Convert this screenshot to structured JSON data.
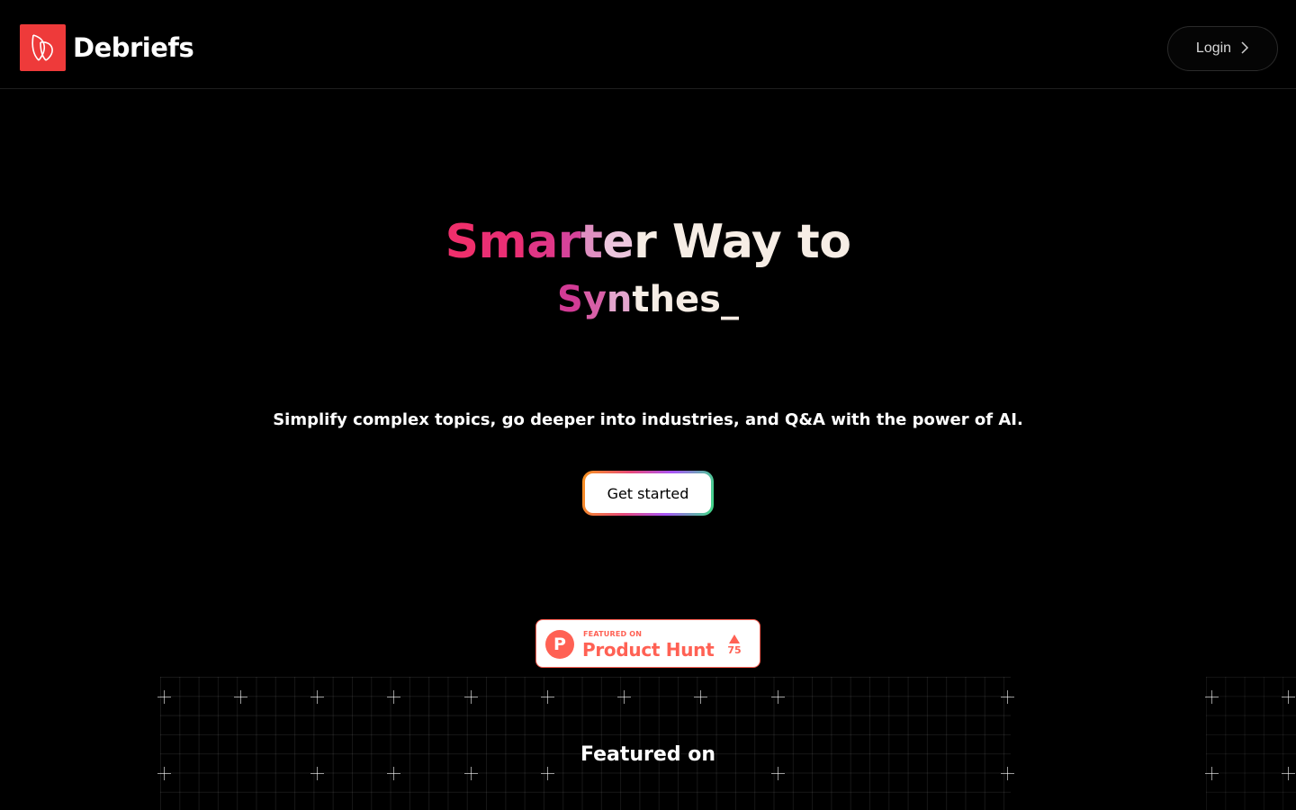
{
  "brand": {
    "name": "Debriefs",
    "accent": "#ee3a3a"
  },
  "nav": {
    "login_label": "Login"
  },
  "hero": {
    "title_parts": [
      {
        "text": "S",
        "color": "#ef2f6c"
      },
      {
        "text": "m",
        "color": "#ea2f74"
      },
      {
        "text": "a",
        "color": "#e03686"
      },
      {
        "text": "r",
        "color": "#d6439a"
      },
      {
        "text": "t",
        "color": "#df8fc1"
      },
      {
        "text": "e",
        "color": "#ecc6dd"
      },
      {
        "text": "r Way to",
        "color": "#f6ede5"
      }
    ],
    "subtitle_parts": [
      {
        "text": "S",
        "color": "#d23b95"
      },
      {
        "text": "y",
        "color": "#d85fa7"
      },
      {
        "text": "n",
        "color": "#e3a5cc"
      },
      {
        "text": "thes_",
        "color": "#f6ede5"
      }
    ],
    "tagline": "Simplify complex topics, go deeper into industries, and Q&A with the power of AI.",
    "cta_label": "Get started"
  },
  "product_hunt": {
    "featured_label": "FEATURED ON",
    "name": "Product Hunt",
    "upvotes": "75",
    "color": "#ff6154",
    "icon": "product-hunt-p-icon"
  },
  "featured_section": {
    "title": "Featured on"
  }
}
